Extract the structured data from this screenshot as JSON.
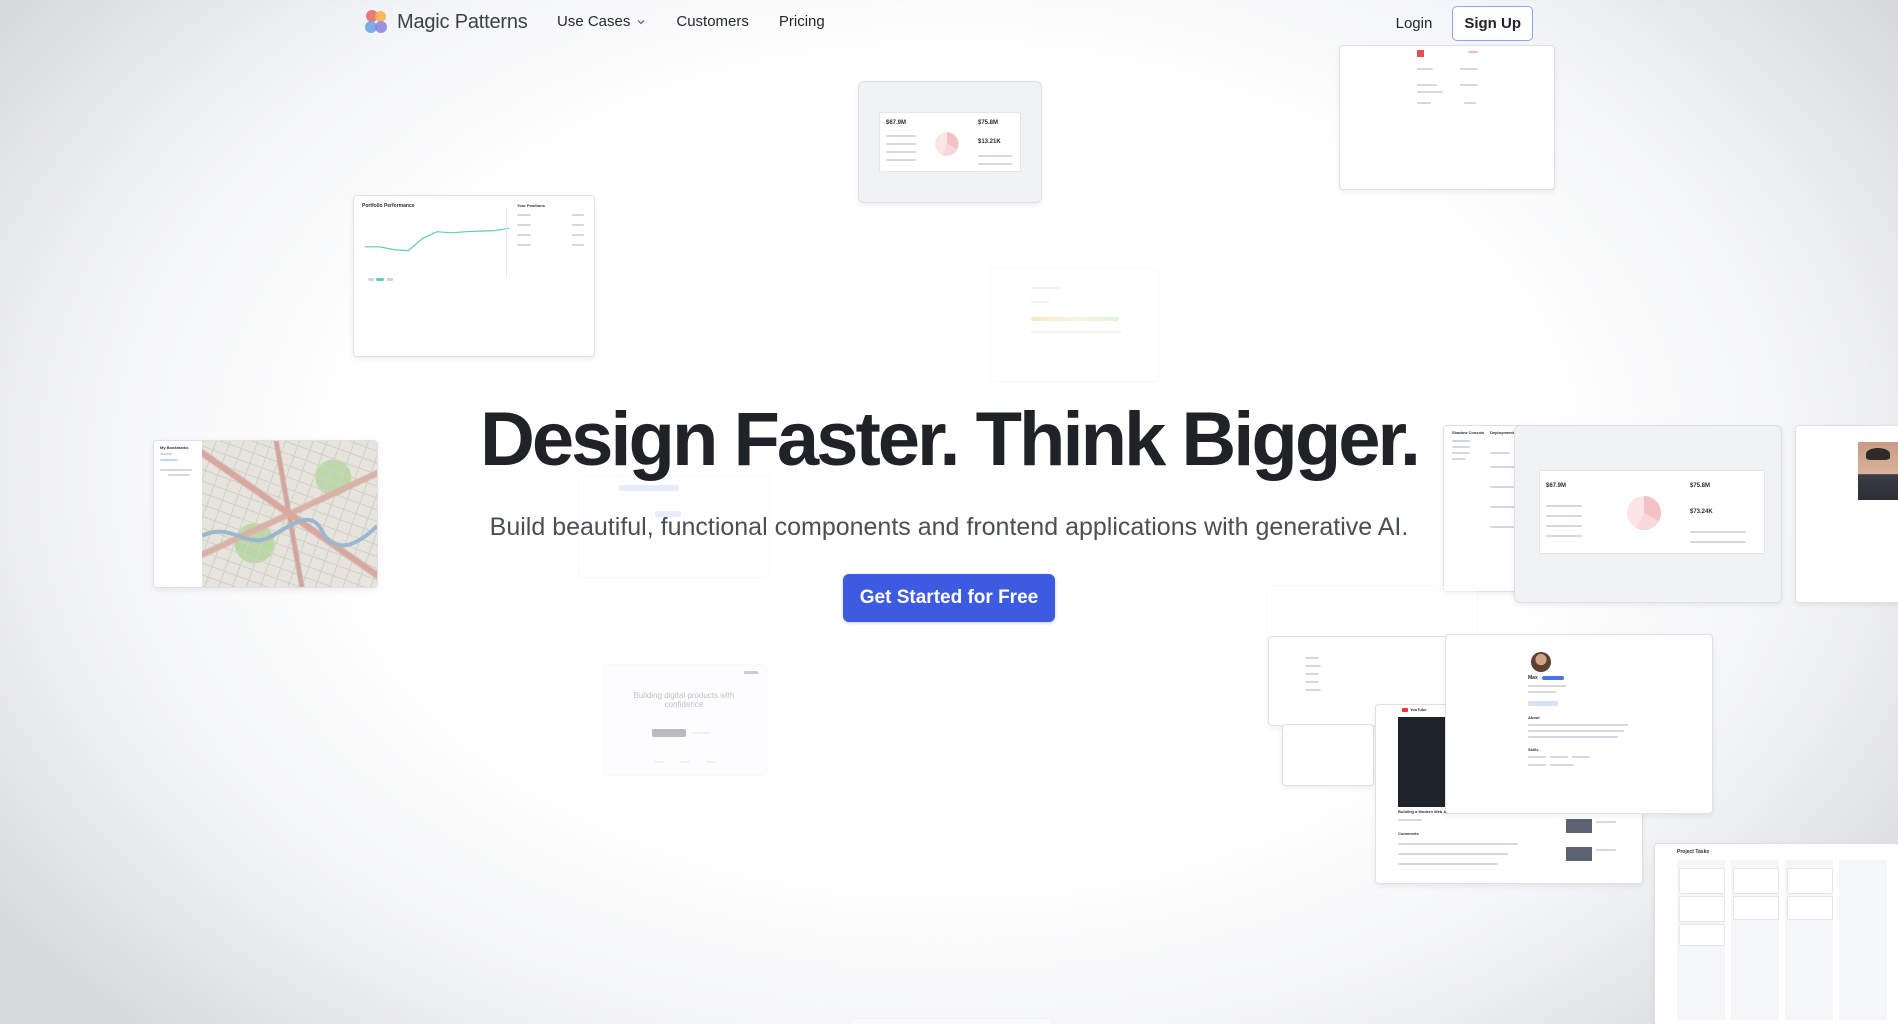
{
  "brand": {
    "name": "Magic Patterns",
    "logo_colors": [
      "#e9797a",
      "#f3b24a",
      "#6fa5ea",
      "#8b7fdc"
    ]
  },
  "nav": {
    "links": [
      {
        "label": "Use Cases",
        "has_dropdown": true
      },
      {
        "label": "Customers",
        "has_dropdown": false
      },
      {
        "label": "Pricing",
        "has_dropdown": false
      }
    ],
    "login_label": "Login",
    "signup_label": "Sign Up"
  },
  "hero": {
    "title": "Design Faster. Think Bigger.",
    "subtitle": "Build beautiful, functional components and frontend applications with generative AI.",
    "cta_label": "Get Started for Free"
  },
  "colors": {
    "accent": "#3d5be0",
    "text": "#1f2328",
    "chart_line": "#5fcfa8"
  },
  "previews": {
    "portfolio": {
      "title": "Portfolio Performance",
      "side_title": "Your Positions",
      "chart_points": [
        0.55,
        0.55,
        0.6,
        0.62,
        0.4,
        0.28,
        0.3,
        0.28,
        0.27,
        0.26,
        0.22
      ]
    },
    "bookmarks": {
      "title": "My Bookmarks"
    },
    "finance_top": {
      "value_a": "$67.9M",
      "value_b": "$75.8M",
      "value_c": "$13.21K"
    },
    "finance_right": {
      "value_a": "$67.9M",
      "value_b": "$75.8M",
      "value_c": "$73.24K"
    },
    "deployments": {
      "nav_title": "Shadow Console",
      "title": "Deployments"
    },
    "profile": {
      "name": "Max",
      "about_label": "About",
      "skills_label": "Skills"
    },
    "video": {
      "brand": "YouTube",
      "title": "Building a Modern Web Application",
      "comments_label": "Comments"
    },
    "kanban": {
      "title": "Project Tasks"
    },
    "landing": {
      "title": "Building digital products with confidence"
    }
  }
}
